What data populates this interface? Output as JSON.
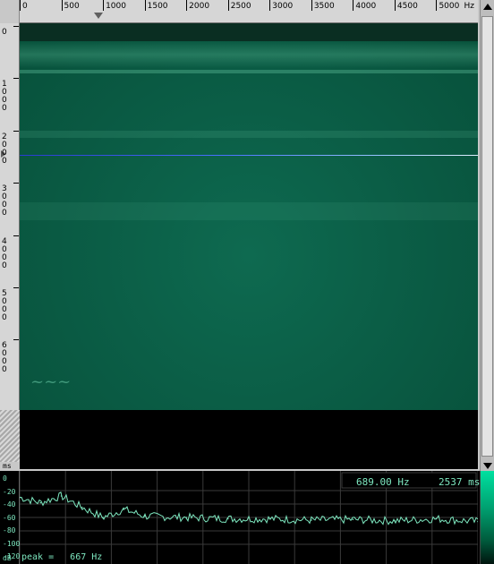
{
  "top_ruler": {
    "ticks": [
      "0",
      "500",
      "1000",
      "1500",
      "2000",
      "2500",
      "3000",
      "3500",
      "4000",
      "4500",
      "5000"
    ],
    "unit": "Hz"
  },
  "left_ruler": {
    "labels": [
      "0",
      "1\n0\n0\n0",
      "2\n0\n0\n0",
      "3\n0\n0\n0",
      "4\n0\n0\n0",
      "5\n0\n0\n0",
      "6\n0\n0\n0"
    ],
    "unit": "ms"
  },
  "spectrum": {
    "frequency_readout": "689.00 Hz",
    "time_readout": "2537 ms",
    "peak_readout": "peak =   667 Hz",
    "db_labels": [
      "0",
      "-20",
      "-40",
      "-60",
      "-80",
      "-100",
      "-120"
    ],
    "db_unit": "dB"
  },
  "colors": {
    "spectrogram_base": "#0a5a43",
    "cursor_line": "#4a72ff",
    "trace": "#7ee8c0"
  },
  "chart_data": {
    "type": "line",
    "xlabel": "Hz",
    "ylabel": "dB",
    "xlim": [
      0,
      5500
    ],
    "ylim": [
      -120,
      0
    ],
    "x": [
      0,
      250,
      500,
      750,
      1000,
      1250,
      1500,
      2000,
      2500,
      3000,
      3500,
      4000,
      4500,
      5000,
      5500
    ],
    "series": [
      {
        "values": [
          -30,
          -38,
          -28,
          -45,
          -60,
          -48,
          -58,
          -60,
          -62,
          -62,
          -64,
          -63,
          -65,
          -62,
          -66
        ]
      }
    ]
  }
}
